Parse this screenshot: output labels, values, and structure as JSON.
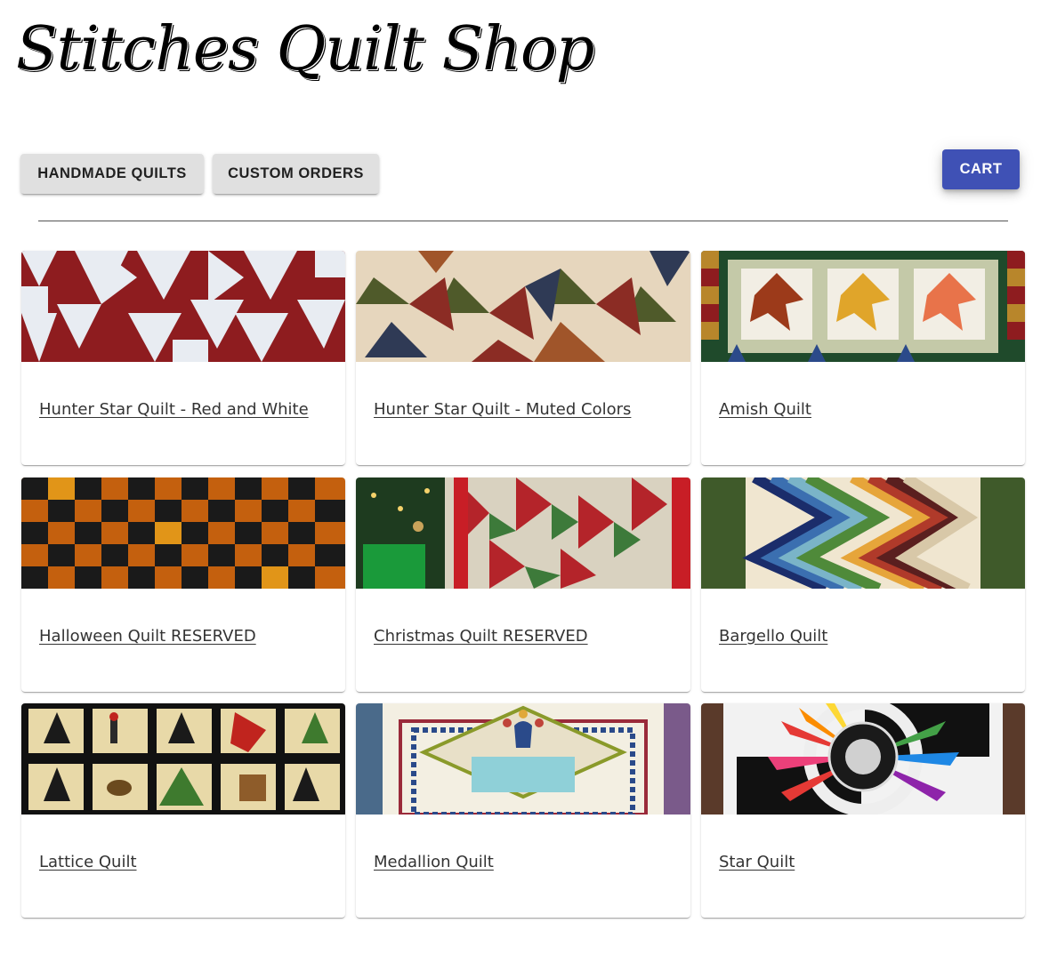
{
  "header": {
    "logo_text": "Stitches Quilt Shop"
  },
  "nav": {
    "handmade_label": "HANDMADE QUILTS",
    "custom_label": "CUSTOM ORDERS",
    "cart_label": "CART"
  },
  "colors": {
    "cart_button": "#3f51b5",
    "nav_button": "#e0e0e0"
  },
  "products": [
    {
      "title": "Hunter Star Quilt - Red and White"
    },
    {
      "title": "Hunter Star Quilt - Muted Colors"
    },
    {
      "title": "Amish Quilt"
    },
    {
      "title": "Halloween Quilt RESERVED"
    },
    {
      "title": "Christmas Quilt RESERVED"
    },
    {
      "title": "Bargello Quilt"
    },
    {
      "title": "Lattice Quilt"
    },
    {
      "title": "Medallion Quilt"
    },
    {
      "title": "Star Quilt"
    }
  ]
}
